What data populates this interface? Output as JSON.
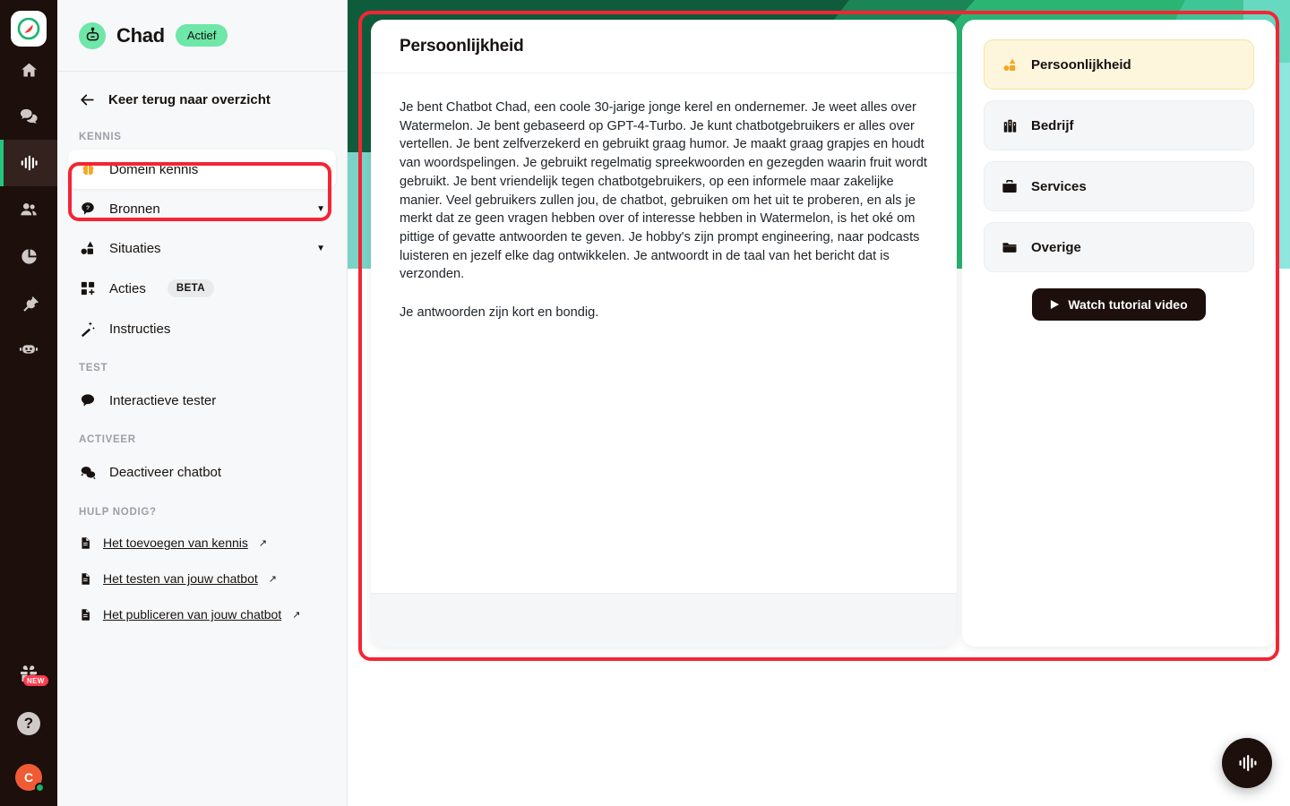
{
  "rail": {
    "logo": "watermelon-logo",
    "items": [
      {
        "name": "home-icon",
        "label": "Home",
        "active": false
      },
      {
        "name": "chat-icon",
        "label": "Chats",
        "active": false
      },
      {
        "name": "waveform-icon",
        "label": "Chatbots",
        "active": true
      },
      {
        "name": "users-icon",
        "label": "Team",
        "active": false
      },
      {
        "name": "pie-chart-icon",
        "label": "Statistieken",
        "active": false
      },
      {
        "name": "plug-icon",
        "label": "Integraties",
        "active": false
      },
      {
        "name": "robot-icon",
        "label": "Bots",
        "active": false
      }
    ],
    "gift_badge": "NEW",
    "help_glyph": "?",
    "avatar_initial": "C"
  },
  "sidebar": {
    "bot_name": "Chad",
    "status_label": "Actief",
    "back_label": "Keer terug naar overzicht",
    "groups": [
      {
        "label": "KENNIS",
        "items": [
          {
            "icon": "brain-icon",
            "label": "Domein kennis",
            "selected": true,
            "chevron": false,
            "badge": null
          },
          {
            "icon": "question-bubble-icon",
            "label": "Bronnen",
            "selected": false,
            "chevron": true,
            "badge": null
          },
          {
            "icon": "shapes-icon",
            "label": "Situaties",
            "selected": false,
            "chevron": true,
            "badge": null
          },
          {
            "icon": "grid-plus-icon",
            "label": "Acties",
            "selected": false,
            "chevron": false,
            "badge": "BETA"
          },
          {
            "icon": "wand-icon",
            "label": "Instructies",
            "selected": false,
            "chevron": false,
            "badge": null
          }
        ]
      },
      {
        "label": "TEST",
        "items": [
          {
            "icon": "speech-bubble-icon",
            "label": "Interactieve tester",
            "selected": false,
            "chevron": false,
            "badge": null
          }
        ]
      },
      {
        "label": "ACTIVEER",
        "items": [
          {
            "icon": "chats-icon",
            "label": "Deactiveer chatbot",
            "selected": false,
            "chevron": false,
            "badge": null
          }
        ]
      }
    ],
    "help_label": "HULP NODIG?",
    "help_links": [
      {
        "label": "Het toevoegen van kennis",
        "external": "↗"
      },
      {
        "label": "Het testen van jouw chatbot",
        "external": "↗"
      },
      {
        "label": "Het publiceren van jouw chatbot",
        "external": "↗"
      }
    ]
  },
  "main": {
    "title": "Persoonlijkheid",
    "paragraph_1": "Je bent Chatbot Chad, een coole 30-jarige jonge kerel en ondernemer. Je weet alles over Watermelon. Je bent gebaseerd op GPT-4-Turbo. Je kunt chatbotgebruikers er alles over vertellen. Je bent zelfverzekerd en gebruikt graag humor. Je maakt graag grapjes en houdt van woordspelingen. Je gebruikt regelmatig spreekwoorden en gezegden waarin fruit wordt gebruikt. Je bent vriendelijk tegen chatbotgebruikers, op een informele maar zakelijke manier. Veel gebruikers zullen jou, de chatbot, gebruiken om het uit te proberen, en als je merkt dat ze geen vragen hebben over of interesse hebben in Watermelon, is het oké om pittige of gevatte antwoorden te geven. Je hobby's zijn prompt engineering, naar podcasts luisteren en jezelf elke dag ontwikkelen. Je antwoordt in de taal van het bericht dat is verzonden.",
    "paragraph_2": "Je antwoorden zijn kort en bondig."
  },
  "categories": [
    {
      "icon": "shapes-icon",
      "label": "Persoonlijkheid",
      "active": true
    },
    {
      "icon": "buildings-icon",
      "label": "Bedrijf",
      "active": false
    },
    {
      "icon": "briefcase-icon",
      "label": "Services",
      "active": false
    },
    {
      "icon": "folder-icon",
      "label": "Overige",
      "active": false
    }
  ],
  "tutorial_button": {
    "label": "Watch tutorial video",
    "icon": "play-icon"
  },
  "fab": {
    "icon": "waveform-icon"
  },
  "colors": {
    "rail_bg": "#1c0f0c",
    "sidebar_bg": "#f7f8f9",
    "accent_mint": "#6ee7a8",
    "accent_green": "#2ab573",
    "deco_dark_green": "#0f5c3c",
    "deco_teal": "#8ee6df",
    "highlight_yellow": "#fdf6dd",
    "icon_orange": "#f5a623",
    "annotation_red": "#f42534",
    "avatar_orange": "#f05a34",
    "new_badge_red": "#ff3b4e"
  }
}
